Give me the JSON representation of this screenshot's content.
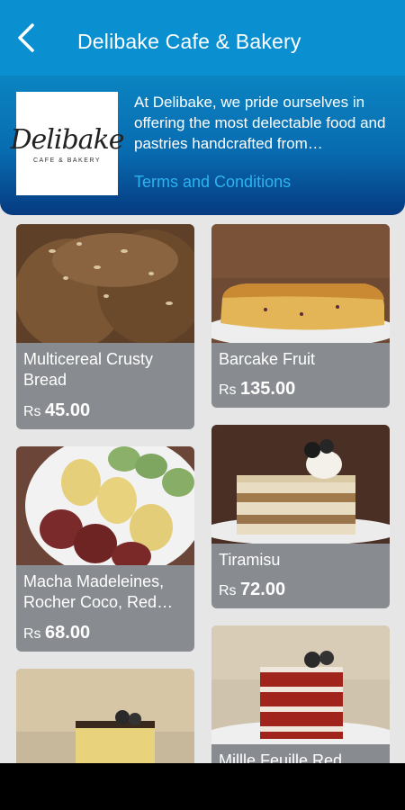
{
  "header": {
    "title": "Delibake Cafe & Bakery"
  },
  "info": {
    "logo_text": "Delibake",
    "logo_sub": "CAFE & BAKERY",
    "description": "At Delibake, we pride ourselves in offering the most delectable food and pastries handcrafted from…",
    "terms_label": "Terms and Conditions"
  },
  "products": [
    {
      "name": "Multicereal Crusty Bread",
      "currency": "Rs",
      "price": "45.00"
    },
    {
      "name": "Barcake Fruit",
      "currency": "Rs",
      "price": "135.00"
    },
    {
      "name": "Macha Madeleines, Rocher Coco, Red…",
      "currency": "Rs",
      "price": "68.00"
    },
    {
      "name": "Tiramisu",
      "currency": "Rs",
      "price": "72.00"
    },
    {
      "name": "",
      "currency": "",
      "price": ""
    },
    {
      "name": "Millle Feuille Red",
      "currency": "",
      "price": ""
    }
  ],
  "colors": {
    "appbar": "#0a8fd0",
    "link": "#2db3ef",
    "card": "#888b90"
  }
}
